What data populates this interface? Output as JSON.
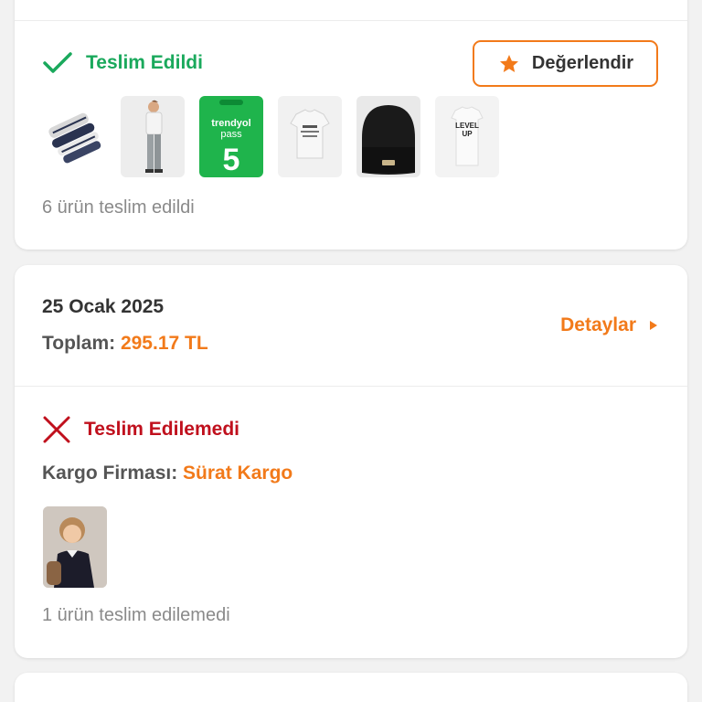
{
  "order_delivered": {
    "status": "Teslim Edildi",
    "rate_button": "Değerlendir",
    "products": [
      {
        "icon": "socks-product-image"
      },
      {
        "icon": "boy-outfit-product-image"
      },
      {
        "icon": "trendyol-pass-product-image",
        "brand": "trendyol",
        "word": "pass",
        "number": "5"
      },
      {
        "icon": "tshirt-product-image"
      },
      {
        "icon": "beanie-product-image"
      },
      {
        "icon": "level-up-tshirt-product-image",
        "text1": "LEVEL",
        "text2": "UP"
      }
    ],
    "summary": "6 ürün teslim edildi"
  },
  "order_failed": {
    "date": "25 Ocak 2025",
    "total_label": "Toplam:",
    "total_value": "295.17 TL",
    "details_label": "Detaylar",
    "status": "Teslim Edilemedi",
    "cargo_label": "Kargo Firması:",
    "cargo_name": "Sürat Kargo",
    "summary": "1 ürün teslim edilemedi"
  },
  "colors": {
    "accent": "#f27a1a",
    "success": "#1aa95c",
    "error": "#c0101d",
    "trendyol_green": "#1fb44c"
  }
}
